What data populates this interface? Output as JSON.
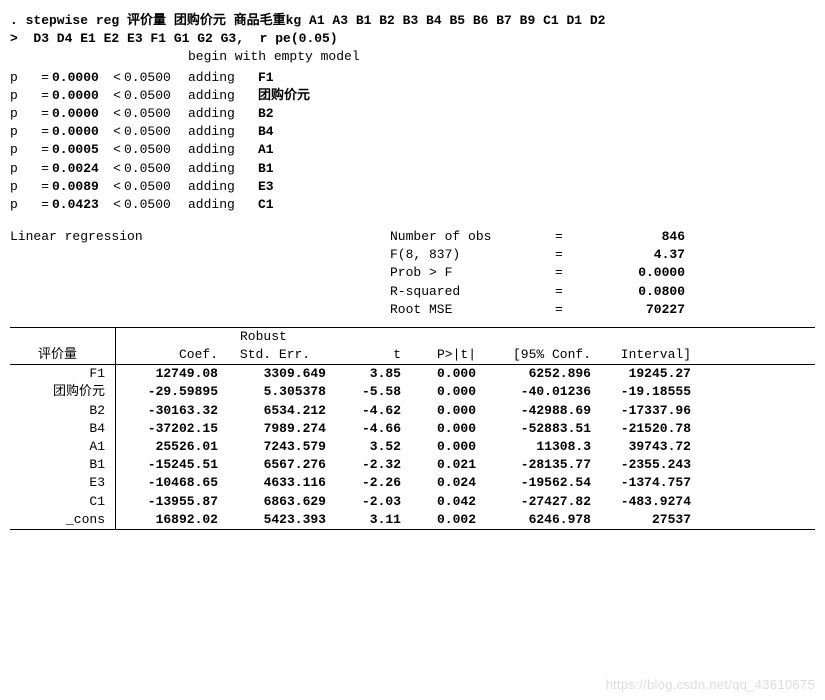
{
  "command": {
    "line1": ". stepwise reg 评价量 团购价元 商品毛重kg A1 A3 B1 B2 B3 B4 B5 B6 B7 B9 C1 D1 D2",
    "line2": ">  D3 D4 E1 E2 E3 F1 G1 G2 G3,  r pe(0.05)"
  },
  "begin_text": "begin with empty model",
  "steps": [
    {
      "p_label": "p",
      "eq": "=",
      "pval": "0.0000",
      "lt": "<",
      "thresh": "0.0500",
      "action": "adding",
      "var": "F1"
    },
    {
      "p_label": "p",
      "eq": "=",
      "pval": "0.0000",
      "lt": "<",
      "thresh": "0.0500",
      "action": "adding",
      "var": "团购价元"
    },
    {
      "p_label": "p",
      "eq": "=",
      "pval": "0.0000",
      "lt": "<",
      "thresh": "0.0500",
      "action": "adding",
      "var": "B2"
    },
    {
      "p_label": "p",
      "eq": "=",
      "pval": "0.0000",
      "lt": "<",
      "thresh": "0.0500",
      "action": "adding",
      "var": "B4"
    },
    {
      "p_label": "p",
      "eq": "=",
      "pval": "0.0005",
      "lt": "<",
      "thresh": "0.0500",
      "action": "adding",
      "var": "A1"
    },
    {
      "p_label": "p",
      "eq": "=",
      "pval": "0.0024",
      "lt": "<",
      "thresh": "0.0500",
      "action": "adding",
      "var": "B1"
    },
    {
      "p_label": "p",
      "eq": "=",
      "pval": "0.0089",
      "lt": "<",
      "thresh": "0.0500",
      "action": "adding",
      "var": "E3"
    },
    {
      "p_label": "p",
      "eq": "=",
      "pval": "0.0423",
      "lt": "<",
      "thresh": "0.0500",
      "action": "adding",
      "var": "C1"
    }
  ],
  "reg_title": "Linear regression",
  "stats": [
    {
      "label": "Number of obs",
      "eq": "=",
      "val": "846"
    },
    {
      "label": "F(8, 837)",
      "eq": "=",
      "val": "4.37"
    },
    {
      "label": "Prob > F",
      "eq": "=",
      "val": "0.0000"
    },
    {
      "label": "R-squared",
      "eq": "=",
      "val": "0.0800"
    },
    {
      "label": "Root MSE",
      "eq": "=",
      "val": "70227"
    }
  ],
  "table": {
    "robust_label": "Robust",
    "depvar": "评价量",
    "headers": {
      "coef": "Coef.",
      "se": "Std. Err.",
      "t": "t",
      "pt": "P>|t|",
      "ciL": "[95% Conf.",
      "ciR": "Interval]"
    },
    "rows": [
      {
        "name": "F1",
        "coef": "12749.08",
        "se": "3309.649",
        "t": "3.85",
        "pt": "0.000",
        "ciL": "6252.896",
        "ciR": "19245.27"
      },
      {
        "name": "团购价元",
        "coef": "-29.59895",
        "se": "5.305378",
        "t": "-5.58",
        "pt": "0.000",
        "ciL": "-40.01236",
        "ciR": "-19.18555"
      },
      {
        "name": "B2",
        "coef": "-30163.32",
        "se": "6534.212",
        "t": "-4.62",
        "pt": "0.000",
        "ciL": "-42988.69",
        "ciR": "-17337.96"
      },
      {
        "name": "B4",
        "coef": "-37202.15",
        "se": "7989.274",
        "t": "-4.66",
        "pt": "0.000",
        "ciL": "-52883.51",
        "ciR": "-21520.78"
      },
      {
        "name": "A1",
        "coef": "25526.01",
        "se": "7243.579",
        "t": "3.52",
        "pt": "0.000",
        "ciL": "11308.3",
        "ciR": "39743.72"
      },
      {
        "name": "B1",
        "coef": "-15245.51",
        "se": "6567.276",
        "t": "-2.32",
        "pt": "0.021",
        "ciL": "-28135.77",
        "ciR": "-2355.243"
      },
      {
        "name": "E3",
        "coef": "-10468.65",
        "se": "4633.116",
        "t": "-2.26",
        "pt": "0.024",
        "ciL": "-19562.54",
        "ciR": "-1374.757"
      },
      {
        "name": "C1",
        "coef": "-13955.87",
        "se": "6863.629",
        "t": "-2.03",
        "pt": "0.042",
        "ciL": "-27427.82",
        "ciR": "-483.9274"
      },
      {
        "name": "_cons",
        "coef": "16892.02",
        "se": "5423.393",
        "t": "3.11",
        "pt": "0.002",
        "ciL": "6246.978",
        "ciR": "27537"
      }
    ]
  },
  "watermark": "https://blog.csdn.net/qq_43610675"
}
